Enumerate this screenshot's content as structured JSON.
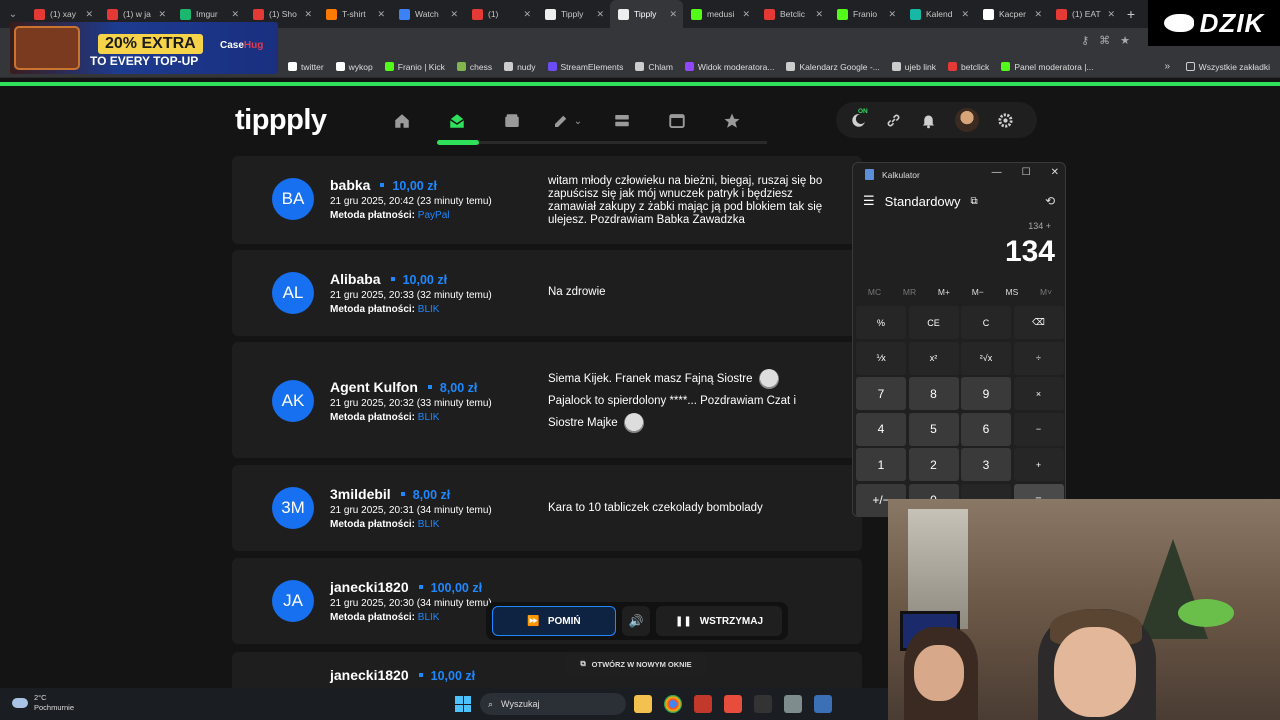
{
  "tabs": [
    {
      "title": "(1) xay",
      "color": "#e53935"
    },
    {
      "title": "(1) w ja",
      "color": "#e53935"
    },
    {
      "title": "Imgur",
      "color": "#1bb76e"
    },
    {
      "title": "(1) Sho",
      "color": "#e53935"
    },
    {
      "title": "T-shirt",
      "color": "#ff7a00"
    },
    {
      "title": "Watch",
      "color": "#3b82f6"
    },
    {
      "title": "(1)",
      "color": "#e53935"
    },
    {
      "title": "Tipply",
      "color": "#eeeeee"
    },
    {
      "title": "Tipply",
      "color": "#eeeeee"
    },
    {
      "title": "medusi",
      "color": "#53fc18"
    },
    {
      "title": "Betclic",
      "color": "#e53935"
    },
    {
      "title": "Franio",
      "color": "#53fc18"
    },
    {
      "title": "Kalend",
      "color": "#17b8a6"
    },
    {
      "title": "Kacper",
      "color": "#ffffff"
    },
    {
      "title": "(1) EAT",
      "color": "#e53935"
    }
  ],
  "bookmarks": [
    {
      "label": "twitter",
      "color": "#ffffff"
    },
    {
      "label": "wykop",
      "color": "#ffffff"
    },
    {
      "label": "Franio | Kick",
      "color": "#53fc18"
    },
    {
      "label": "chess",
      "color": "#81b64c"
    },
    {
      "label": "nudy",
      "color": "#cccccc"
    },
    {
      "label": "StreamElements",
      "color": "#6c4cf5"
    },
    {
      "label": "Chlam",
      "color": "#cccccc"
    },
    {
      "label": "Widok moderatora...",
      "color": "#9146ff"
    },
    {
      "label": "Kalendarz Google -...",
      "color": "#cccccc"
    },
    {
      "label": "ujeb link",
      "color": "#cccccc"
    },
    {
      "label": "betclick",
      "color": "#e53935"
    },
    {
      "label": "Panel moderatora |...",
      "color": "#53fc18"
    }
  ],
  "bookmarks_all": "Wszystkie zakładki",
  "ad": {
    "badge": "20% EXTRA",
    "line2": "TO EVERY TOP-UP",
    "brand_a": "Case",
    "brand_b": "Hug"
  },
  "dzik": "DZIK",
  "app": {
    "logo": "tippply",
    "theme_badge": "ON"
  },
  "donations": [
    {
      "initials": "BA",
      "name": "babka",
      "amount": "10,00 zł",
      "date": "21 gru 2025, 20:42 (23 minuty temu)",
      "pay_label": "Metoda płatności:",
      "method": "PayPal",
      "message": "witam młody człowieku na bieżni, biegaj, ruszaj się bo zapuścisz się jak mój wnuczek patryk i będziesz zamawiał zakupy z żabki mając ją pod blokiem tak się ulejesz. Pozdrawiam Babka Zawadzka"
    },
    {
      "initials": "AL",
      "name": "Alibaba",
      "amount": "10,00 zł",
      "date": "21 gru 2025, 20:33 (32 minuty temu)",
      "pay_label": "Metoda płatności:",
      "method": "BLIK",
      "message": "Na zdrowie"
    },
    {
      "initials": "AK",
      "name": "Agent Kulfon",
      "amount": "8,00 zł",
      "date": "21 gru 2025, 20:32 (33 minuty temu)",
      "pay_label": "Metoda płatności:",
      "method": "BLIK",
      "message_1": "Siema Kijek. Franek masz Fajną Siostre",
      "message_2": "Pajalock to spierdolony ****... Pozdrawiam Czat i",
      "message_3": "Siostre Majke"
    },
    {
      "initials": "3M",
      "name": "3mildebil",
      "amount": "8,00 zł",
      "date": "21 gru 2025, 20:31 (34 minuty temu)",
      "pay_label": "Metoda płatności:",
      "method": "BLIK",
      "message": "Kara to 10 tabliczek czekolady bombolady"
    },
    {
      "initials": "JA",
      "name": "janecki1820",
      "amount": "100,00 zł",
      "date": "21 gru 2025, 20:30 (34 minuty temu)",
      "pay_label": "Metoda płatności:",
      "method": "BLIK",
      "message": ""
    },
    {
      "initials": "JA",
      "name": "janecki1820",
      "amount": "10,00 zł",
      "date": "",
      "pay_label": "",
      "method": "",
      "message": ""
    }
  ],
  "player": {
    "skip": "POMIŃ",
    "pause": "WSTRZYMAJ",
    "open_new": "OTWÓRZ W NOWYM OKNIE"
  },
  "calculator": {
    "title": "Kalkulator",
    "mode": "Standardowy",
    "expression": "134 +",
    "display": "134",
    "memory": [
      "MC",
      "MR",
      "M+",
      "M−",
      "MS",
      "M˅"
    ],
    "keys": [
      "%",
      "CE",
      "C",
      "⌫",
      "⅟x",
      "x²",
      "²√x",
      "÷",
      "7",
      "8",
      "9",
      "×",
      "4",
      "5",
      "6",
      "−",
      "1",
      "2",
      "3",
      "+",
      "+/−",
      "0",
      "",
      "="
    ]
  },
  "taskbar": {
    "temp": "2°C",
    "weather": "Pochmurnie",
    "search": "Wyszukaj"
  }
}
